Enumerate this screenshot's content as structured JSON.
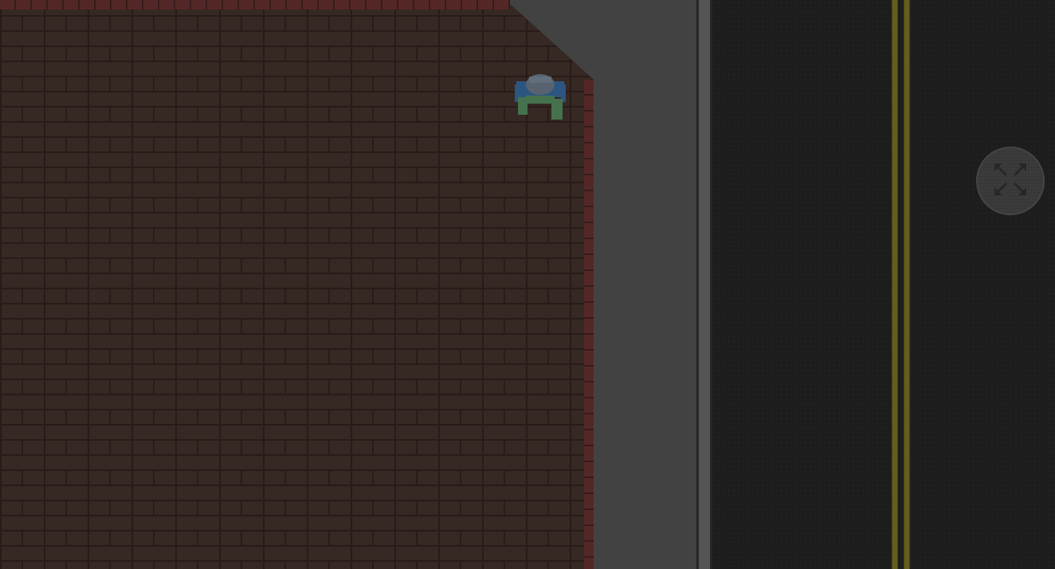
{
  "scene": {
    "type": "top-down-game-view",
    "zones": [
      "brick-roof",
      "sidewalk",
      "curb",
      "road"
    ]
  },
  "player": {
    "icon": "player-character-icon",
    "colors": {
      "head": "#5f6a78",
      "body": "#2f5c8a",
      "legs": "#4a7a52"
    }
  },
  "controls": {
    "fullscreen": {
      "icon": "fullscreen-toggle-icon"
    }
  },
  "colors": {
    "brick": "#3a2b26",
    "brick_edge": "#5a2a2a",
    "sidewalk": "#474747",
    "road": "#1f1f1f",
    "road_line": "#6a6420"
  }
}
